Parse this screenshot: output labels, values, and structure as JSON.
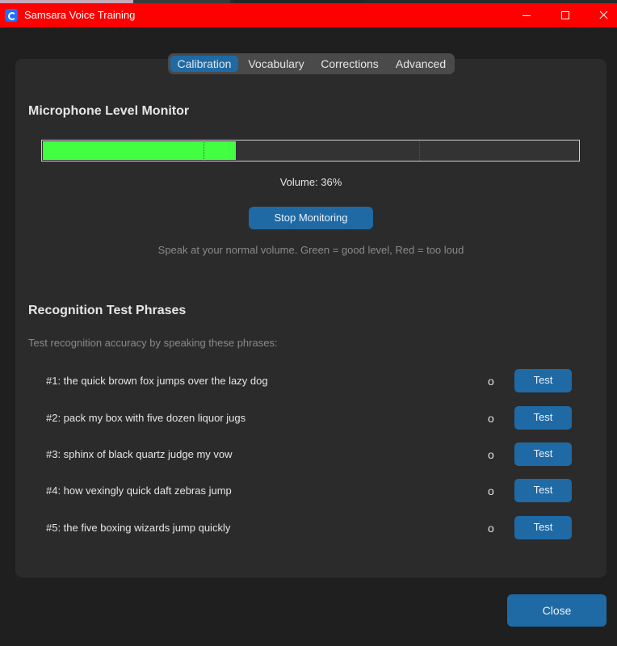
{
  "window": {
    "title": "Samsara Voice Training"
  },
  "tabs": [
    {
      "label": "Calibration",
      "active": true
    },
    {
      "label": "Vocabulary",
      "active": false
    },
    {
      "label": "Corrections",
      "active": false
    },
    {
      "label": "Advanced",
      "active": false
    }
  ],
  "mic": {
    "title": "Microphone Level Monitor",
    "level_fraction": 0.36,
    "volume_text": "Volume: 36%",
    "stop_label": "Stop Monitoring",
    "hint": "Speak at your normal volume. Green = good level, Red = too loud",
    "fill_color": "#42ff42"
  },
  "recognition": {
    "title": "Recognition Test Phrases",
    "subtitle": "Test recognition accuracy by speaking these phrases:",
    "phrases": [
      {
        "text": "#1: the quick brown fox jumps over the lazy dog",
        "status": "o",
        "button": "Test"
      },
      {
        "text": "#2: pack my box with five dozen liquor jugs",
        "status": "o",
        "button": "Test"
      },
      {
        "text": "#3: sphinx of black quartz judge my vow",
        "status": "o",
        "button": "Test"
      },
      {
        "text": "#4: how vexingly quick daft zebras jump",
        "status": "o",
        "button": "Test"
      },
      {
        "text": "#5: the five boxing wizards jump quickly",
        "status": "o",
        "button": "Test"
      }
    ]
  },
  "footer": {
    "close_label": "Close"
  },
  "colors": {
    "accent": "#1f6aa5",
    "titlebar": "#ff0000",
    "panel": "#2b2b2b",
    "background": "#1f1f1f"
  }
}
